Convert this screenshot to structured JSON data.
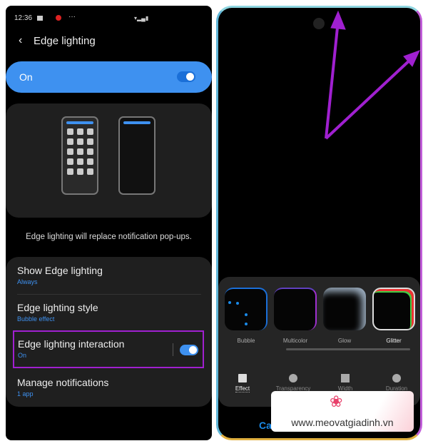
{
  "left": {
    "status": {
      "time": "12:36",
      "more": "···"
    },
    "header": {
      "back_icon": "chevron-left-icon",
      "title": "Edge lighting"
    },
    "master": {
      "label": "On",
      "state": true
    },
    "description": "Edge lighting will replace notification pop-ups.",
    "items": [
      {
        "title": "Show Edge lighting",
        "sub": "Always"
      },
      {
        "title": "Edge lighting style",
        "sub": "Bubble effect"
      },
      {
        "title": "Edge lighting interaction",
        "sub": "On",
        "toggle": true
      },
      {
        "title": "Manage notifications",
        "sub": "1 app"
      }
    ],
    "accent": "#3e91f0",
    "highlight": "#a020d0"
  },
  "right": {
    "effects": [
      {
        "label": "Bubble"
      },
      {
        "label": "Multicolor"
      },
      {
        "label": "Glow"
      },
      {
        "label": "Glitter",
        "selected": true
      }
    ],
    "tabs": [
      {
        "label": "Effect",
        "icon": "effect-icon",
        "active": true
      },
      {
        "label": "Transparency",
        "icon": "transparency-icon"
      },
      {
        "label": "Width",
        "icon": "width-icon"
      },
      {
        "label": "Duration",
        "icon": "clock-icon"
      }
    ],
    "cancel": "Ca",
    "arrow_color": "#a020d0"
  },
  "watermark": {
    "url": "www.meovatgiadinh.vn"
  }
}
